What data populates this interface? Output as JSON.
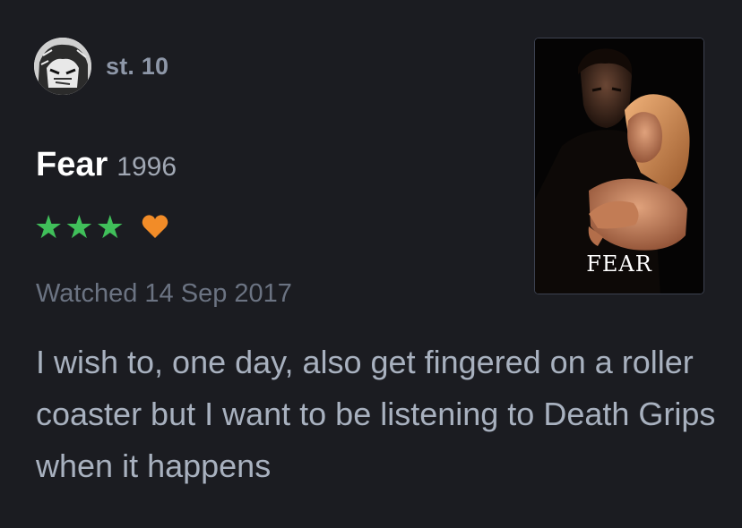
{
  "reviewer": {
    "username": "st. 10",
    "avatar_icon": "avatar-icon"
  },
  "film": {
    "title": "Fear",
    "year": "1996",
    "poster_title": "FEAR"
  },
  "rating": {
    "stars": 3,
    "star_glyph": "★",
    "liked": true,
    "star_color": "#40bf5a",
    "heart_color": "#f28c28"
  },
  "watched": "Watched 14 Sep 2017",
  "review": "I wish to, one day, also get fingered on a roller coaster but I want to be listening to Death Grips when it happens"
}
